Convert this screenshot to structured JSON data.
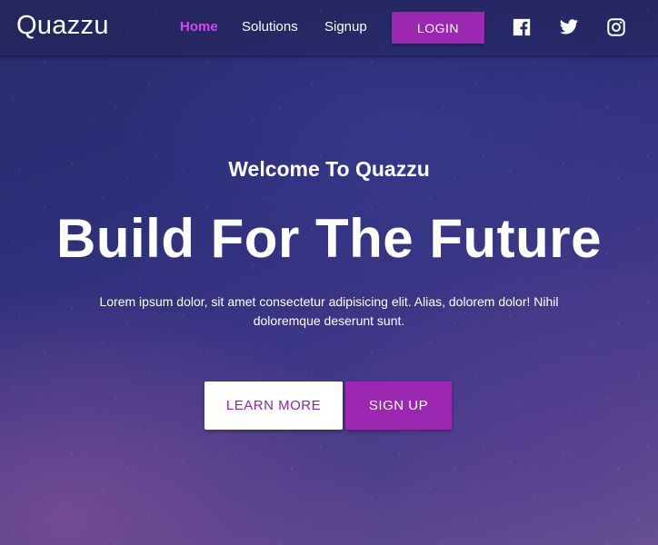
{
  "navbar": {
    "brand": "Quazzu",
    "links": [
      {
        "label": "Home",
        "active": true
      },
      {
        "label": "Solutions",
        "active": false
      },
      {
        "label": "Signup",
        "active": false
      }
    ],
    "login_label": "LOGIN",
    "social_icons": [
      "facebook-icon",
      "twitter-icon",
      "instagram-icon"
    ]
  },
  "hero": {
    "welcome": "Welcome To Quazzu",
    "headline": "Build For The Future",
    "description": "Lorem ipsum dolor, sit amet consectetur adipisicing elit. Alias, dolorem dolor! Nihil doloremque deserunt sunt.",
    "learn_more_label": "LEARN MORE",
    "sign_up_label": "SIGN UP"
  },
  "colors": {
    "accent": "#9c27b0",
    "active_link": "#e040fb",
    "learn_more_text": "#8e24aa"
  }
}
